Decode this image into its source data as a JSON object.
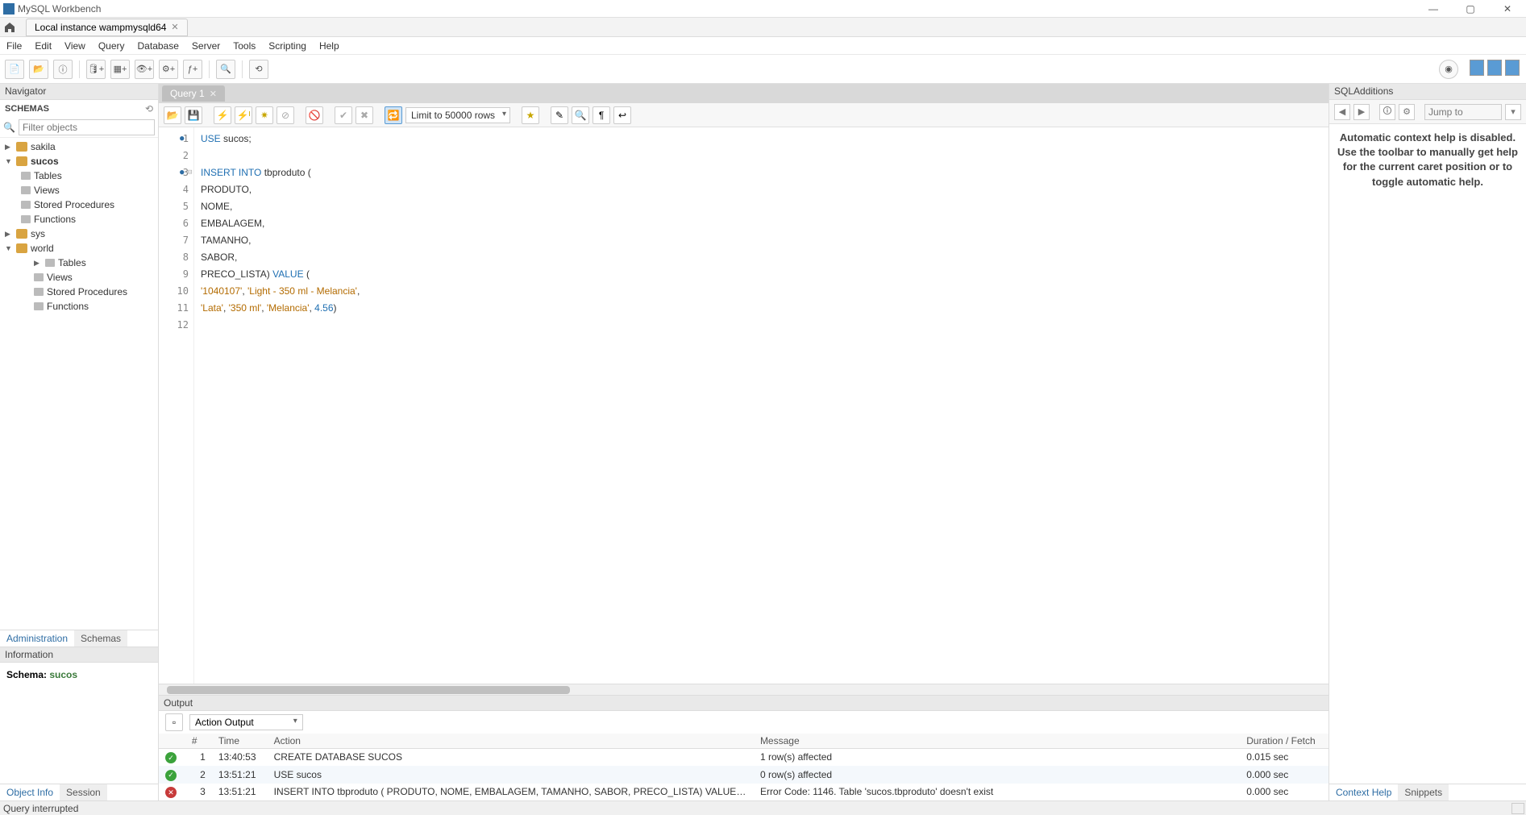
{
  "titlebar": {
    "title": "MySQL Workbench"
  },
  "conntab": {
    "label": "Local instance wampmysqld64"
  },
  "menubar": [
    "File",
    "Edit",
    "View",
    "Query",
    "Database",
    "Server",
    "Tools",
    "Scripting",
    "Help"
  ],
  "navigator": {
    "title": "Navigator",
    "schemasLabel": "SCHEMAS",
    "filterPlaceholder": "Filter objects",
    "tree": {
      "sakila": "sakila",
      "sucos": "sucos",
      "sucosChildren": {
        "tables": "Tables",
        "views": "Views",
        "sp": "Stored Procedures",
        "fn": "Functions"
      },
      "sys": "sys",
      "world": "world",
      "worldChildren": {
        "tables": "Tables",
        "views": "Views",
        "sp": "Stored Procedures",
        "fn": "Functions"
      }
    },
    "bottomTabs": {
      "admin": "Administration",
      "schemas": "Schemas"
    },
    "infoTitle": "Information",
    "schemaLabel": "Schema: ",
    "schemaValue": "sucos",
    "infoTabs": {
      "object": "Object Info",
      "session": "Session"
    }
  },
  "editor": {
    "tabLabel": "Query 1",
    "limitLabel": "Limit to 50000 rows",
    "lines": [
      {
        "raw": "USE sucos;",
        "tokens": [
          {
            "t": "kw",
            "v": "USE"
          },
          {
            "t": "ident",
            "v": " sucos;"
          }
        ]
      },
      {
        "raw": "",
        "tokens": []
      },
      {
        "raw": "INSERT INTO tbproduto (",
        "tokens": [
          {
            "t": "kw",
            "v": "INSERT INTO"
          },
          {
            "t": "ident",
            "v": " tbproduto ("
          }
        ]
      },
      {
        "raw": "PRODUTO,",
        "tokens": [
          {
            "t": "ident",
            "v": "PRODUTO,"
          }
        ]
      },
      {
        "raw": "NOME,",
        "tokens": [
          {
            "t": "ident",
            "v": "NOME,"
          }
        ]
      },
      {
        "raw": "EMBALAGEM,",
        "tokens": [
          {
            "t": "ident",
            "v": "EMBALAGEM,"
          }
        ]
      },
      {
        "raw": "TAMANHO,",
        "tokens": [
          {
            "t": "ident",
            "v": "TAMANHO,"
          }
        ]
      },
      {
        "raw": "SABOR,",
        "tokens": [
          {
            "t": "ident",
            "v": "SABOR,"
          }
        ]
      },
      {
        "raw": "PRECO_LISTA) VALUE (",
        "tokens": [
          {
            "t": "ident",
            "v": "PRECO_LISTA) "
          },
          {
            "t": "kw",
            "v": "VALUE"
          },
          {
            "t": "ident",
            "v": " ("
          }
        ]
      },
      {
        "raw": "'1040107', 'Light - 350 ml - Melancia',",
        "tokens": [
          {
            "t": "str",
            "v": "'1040107'"
          },
          {
            "t": "ident",
            "v": ", "
          },
          {
            "t": "str",
            "v": "'Light - 350 ml - Melancia'"
          },
          {
            "t": "ident",
            "v": ","
          }
        ]
      },
      {
        "raw": "'Lata', '350 ml', 'Melancia', 4.56)",
        "tokens": [
          {
            "t": "str",
            "v": "'Lata'"
          },
          {
            "t": "ident",
            "v": ", "
          },
          {
            "t": "str",
            "v": "'350 ml'"
          },
          {
            "t": "ident",
            "v": ", "
          },
          {
            "t": "str",
            "v": "'Melancia'"
          },
          {
            "t": "ident",
            "v": ", "
          },
          {
            "t": "num",
            "v": "4.56"
          },
          {
            "t": "ident",
            "v": ")"
          }
        ]
      },
      {
        "raw": "",
        "tokens": []
      }
    ]
  },
  "output": {
    "title": "Output",
    "selector": "Action Output",
    "headers": {
      "num": "#",
      "time": "Time",
      "action": "Action",
      "message": "Message",
      "duration": "Duration / Fetch"
    },
    "rows": [
      {
        "status": "ok",
        "num": "1",
        "time": "13:40:53",
        "action": "CREATE DATABASE SUCOS",
        "message": "1 row(s) affected",
        "duration": "0.015 sec"
      },
      {
        "status": "ok",
        "num": "2",
        "time": "13:51:21",
        "action": "USE sucos",
        "message": "0 row(s) affected",
        "duration": "0.000 sec"
      },
      {
        "status": "err",
        "num": "3",
        "time": "13:51:21",
        "action": "INSERT INTO tbproduto ( PRODUTO, NOME, EMBALAGEM, TAMANHO, SABOR, PRECO_LISTA) VALUE ( '1...",
        "message": "Error Code: 1146. Table 'sucos.tbproduto' doesn't exist",
        "duration": "0.000 sec"
      }
    ]
  },
  "additions": {
    "title": "SQLAdditions",
    "jumpLabel": "Jump to",
    "helpText": "Automatic context help is disabled. Use the toolbar to manually get help for the current caret position or to toggle automatic help.",
    "tabs": {
      "context": "Context Help",
      "snippets": "Snippets"
    }
  },
  "statusbar": {
    "text": "Query interrupted"
  }
}
